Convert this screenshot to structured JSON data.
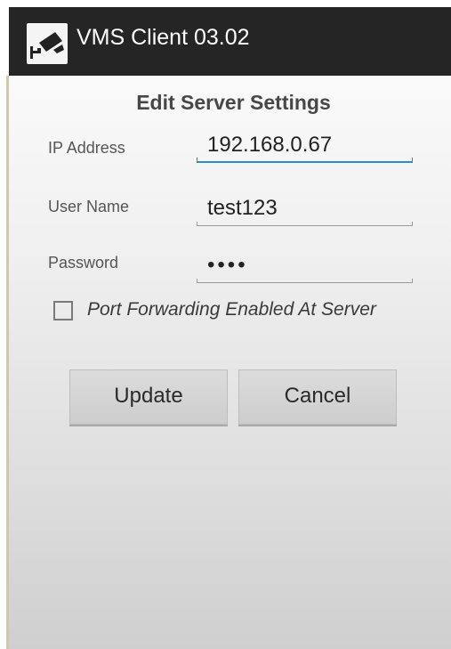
{
  "app": {
    "title": "VMS Client 03.02",
    "icon": "cctv-camera-icon"
  },
  "dialog": {
    "heading": "Edit Server Settings",
    "fields": {
      "ip_label": "IP Address",
      "ip_value": "192.168.0.67",
      "user_label": "User Name",
      "user_value": "test123",
      "password_label": "Password",
      "password_value": "••••"
    },
    "port_forwarding": {
      "label": "Port Forwarding Enabled At Server",
      "checked": false
    },
    "buttons": {
      "update": "Update",
      "cancel": "Cancel"
    }
  },
  "colors": {
    "titlebar": "#252525",
    "focus_accent": "#2a8fbf"
  }
}
